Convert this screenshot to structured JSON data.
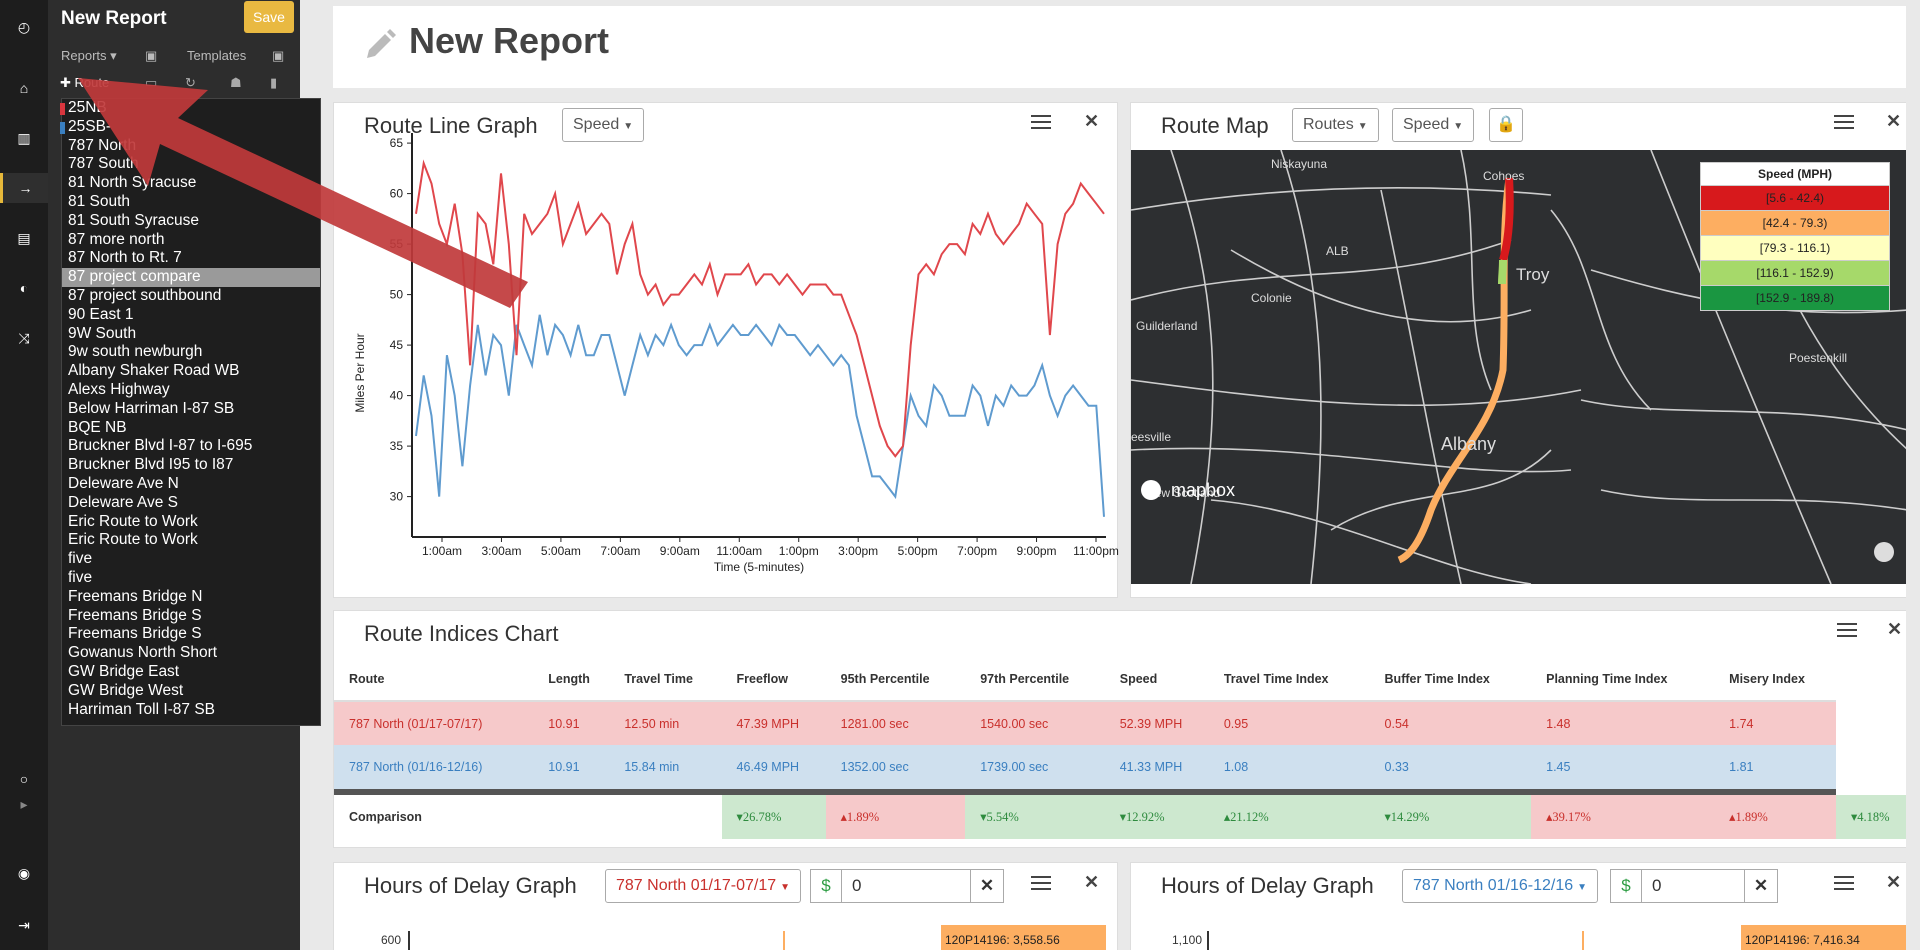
{
  "sidebar": {
    "title": "New Report",
    "save_label": "Save",
    "reports_label": "Reports",
    "templates_label": "Templates",
    "route_label": "Route",
    "routes": [
      {
        "label": "25NB",
        "color": "#d9363e"
      },
      {
        "label": "25SB-",
        "color": "#3a7fc0"
      },
      {
        "label": "787 North"
      },
      {
        "label": "787 South"
      },
      {
        "label": "81 North Syracuse"
      },
      {
        "label": "81 South"
      },
      {
        "label": "81 South Syracuse"
      },
      {
        "label": "87 more north"
      },
      {
        "label": "87 North to Rt. 7"
      },
      {
        "label": "87 project compare",
        "selected": true
      },
      {
        "label": "87 project southbound"
      },
      {
        "label": "90 East 1"
      },
      {
        "label": "9W South"
      },
      {
        "label": "9w south newburgh"
      },
      {
        "label": "Albany Shaker Road WB"
      },
      {
        "label": "Alexs Highway"
      },
      {
        "label": "Below Harriman I-87 SB"
      },
      {
        "label": "BQE NB"
      },
      {
        "label": "Bruckner Blvd I-87 to I-695"
      },
      {
        "label": "Bruckner Blvd I95 to I87"
      },
      {
        "label": "Deleware Ave N"
      },
      {
        "label": "Deleware Ave S"
      },
      {
        "label": "Eric Route to Work"
      },
      {
        "label": "Eric Route to Work"
      },
      {
        "label": "five"
      },
      {
        "label": "five"
      },
      {
        "label": "Freemans Bridge N"
      },
      {
        "label": "Freemans Bridge S"
      },
      {
        "label": "Freemans Bridge S"
      },
      {
        "label": "Gowanus North Short"
      },
      {
        "label": "GW Bridge East"
      },
      {
        "label": "GW Bridge West"
      },
      {
        "label": "Harriman Toll I-87 SB"
      }
    ]
  },
  "header": {
    "title": "New Report"
  },
  "line_graph": {
    "title": "Route Line Graph",
    "dropdown": "Speed",
    "chart_data": {
      "type": "line",
      "ylabel": "Miles Per Hour",
      "xlabel": "Time (5-minutes)",
      "ylim": [
        26,
        66
      ],
      "yticks": [
        "65",
        "60",
        "55",
        "50",
        "45",
        "40",
        "35",
        "30"
      ],
      "xticks": [
        "1:00am",
        "3:00am",
        "5:00am",
        "7:00am",
        "9:00am",
        "11:00am",
        "1:00pm",
        "3:00pm",
        "5:00pm",
        "7:00pm",
        "9:00pm",
        "11:00pm"
      ],
      "series": [
        {
          "color": "#e0474c",
          "values": [
            58,
            63,
            61,
            57,
            55,
            59,
            54,
            43,
            58,
            57,
            53,
            62,
            55,
            44,
            58,
            56,
            57,
            58,
            60,
            55,
            57,
            59,
            56,
            57,
            58,
            57,
            52,
            55,
            57,
            52,
            50,
            51,
            49,
            50,
            50,
            51,
            52,
            51,
            53,
            50,
            52,
            52,
            52,
            53,
            51,
            52,
            52,
            51,
            52,
            51,
            50,
            51,
            51,
            51,
            50,
            50,
            48,
            46,
            43,
            40,
            37,
            35,
            34,
            35,
            45,
            52,
            53,
            52,
            54,
            55,
            55,
            54,
            57,
            56,
            58,
            56,
            55,
            56,
            57,
            59,
            58,
            57,
            46,
            55,
            58,
            59,
            61,
            60,
            59,
            58
          ]
        },
        {
          "color": "#5f9bcf",
          "values": [
            36,
            42,
            38,
            30,
            44,
            40,
            33,
            41,
            47,
            42,
            46,
            45,
            40,
            47,
            45,
            43,
            48,
            44,
            47,
            46,
            44,
            47,
            44,
            44,
            46,
            46,
            43,
            40,
            43,
            46,
            44,
            46,
            45,
            47,
            45,
            44,
            45,
            45,
            47,
            45,
            46,
            47,
            46,
            46,
            47,
            46,
            45,
            47,
            46,
            46,
            45,
            44,
            45,
            44,
            43,
            44,
            43,
            38,
            35,
            32,
            32,
            31,
            30,
            35,
            40,
            38,
            37,
            41,
            40,
            38,
            38,
            38,
            41,
            40,
            37,
            40,
            39,
            41,
            40,
            40,
            41,
            43,
            40,
            38,
            40,
            41,
            40,
            39,
            39,
            28
          ]
        }
      ]
    }
  },
  "route_map": {
    "title": "Route Map",
    "routes_dd": "Routes",
    "speed_dd": "Speed",
    "legend_title": "Speed (MPH)",
    "legend": [
      {
        "label": "[5.6 - 42.4)",
        "color": "#d7191c"
      },
      {
        "label": "[42.4 - 79.3)",
        "color": "#fdae61"
      },
      {
        "label": "[79.3 - 116.1)",
        "color": "#ffffbf"
      },
      {
        "label": "[116.1 - 152.9)",
        "color": "#a6d96a"
      },
      {
        "label": "[152.9 - 189.8)",
        "color": "#1a9641"
      }
    ],
    "places": [
      "Niskayuna",
      "Cohoes",
      "ALB",
      "Troy",
      "Colonie",
      "Guilderland",
      "Poestenkill",
      "Albany",
      "eesville",
      "New Scotland"
    ],
    "attribution": "mapbox"
  },
  "indices": {
    "title": "Route Indices Chart",
    "columns": [
      "Route",
      "Length",
      "Travel Time",
      "Freeflow",
      "95th Percentile",
      "97th Percentile",
      "Speed",
      "Travel Time Index",
      "Buffer Time Index",
      "Planning Time Index",
      "Misery Index"
    ],
    "rows": [
      {
        "cells": [
          "787 North (01/17-07/17)",
          "10.91",
          "12.50 min",
          "47.39 MPH",
          "1281.00 sec",
          "1540.00 sec",
          "52.39 MPH",
          "0.95",
          "0.54",
          "1.48",
          "1.74"
        ],
        "bg": "#f6c9ca",
        "fg": "#c9302c"
      },
      {
        "cells": [
          "787 North (01/16-12/16)",
          "10.91",
          "15.84 min",
          "46.49 MPH",
          "1352.00 sec",
          "1739.00 sec",
          "41.33 MPH",
          "1.08",
          "0.33",
          "1.45",
          "1.81"
        ],
        "bg": "#cfe0ee",
        "fg": "#3a7fc0"
      }
    ],
    "comparison_label": "Comparison",
    "comparison": [
      {
        "text": "▾26.78%",
        "good": true
      },
      {
        "text": "▴1.89%",
        "good": false
      },
      {
        "text": "▾5.54%",
        "good": true
      },
      {
        "text": "▾12.92%",
        "good": true
      },
      {
        "text": "▴21.12%",
        "good": true
      },
      {
        "text": "▾14.29%",
        "good": true
      },
      {
        "text": "▴39.17%",
        "good": false
      },
      {
        "text": "▴1.89%",
        "good": false
      },
      {
        "text": "▾4.18%",
        "good": true
      }
    ]
  },
  "delay_left": {
    "title": "Hours of Delay Graph",
    "dropdown": "787 North 01/17-07/17",
    "value": "0",
    "ytick": "600",
    "bar_label": "120P14196: 3,558.56"
  },
  "delay_right": {
    "title": "Hours of Delay Graph",
    "dropdown": "787 North 01/16-12/16",
    "value": "0",
    "ytick": "1,100",
    "bar_label": "120P14196: 7,416.34"
  }
}
